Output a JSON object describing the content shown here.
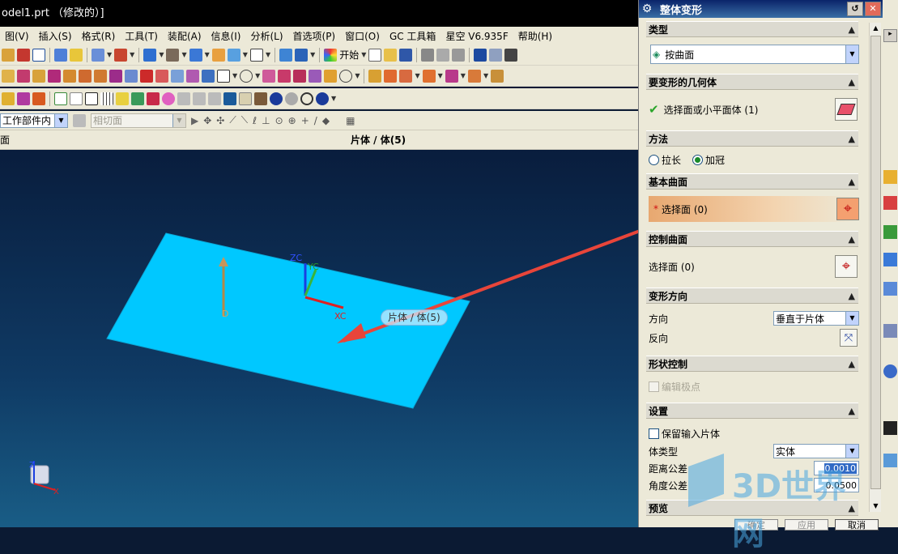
{
  "window": {
    "title": "odel1.prt （修改的）]"
  },
  "menu": [
    "图(V)",
    "插入(S)",
    "格式(R)",
    "工具(T)",
    "装配(A)",
    "信息(I)",
    "分析(L)",
    "首选项(P)",
    "窗口(O)",
    "GC 工具箱",
    "星空 V6.935F",
    "帮助(H)"
  ],
  "toolbar": {
    "start_label": "开始"
  },
  "filter": {
    "scope_value": "工作部件内",
    "snap_value": "相切面"
  },
  "selection_bar": {
    "left_label": "面",
    "right_label": "片体 / 体(5)"
  },
  "viewport": {
    "tooltip": "片体 / 体(5)",
    "axis_zc": "ZC",
    "axis_yc": "YC",
    "axis_xc": "XC",
    "axis_d": "D",
    "triad_z": "Z",
    "triad_x": "X",
    "colors": {
      "sheet": "#00c8ff",
      "arrow": "#e8453a"
    }
  },
  "dialog": {
    "title": "整体变形",
    "sections": {
      "type": "类型",
      "geometry": "要变形的几何体",
      "method": "方法",
      "base": "基本曲面",
      "control": "控制曲面",
      "direction": "变形方向",
      "shape": "形状控制",
      "settings": "设置",
      "preview": "预览"
    },
    "type_value": "按曲面",
    "geometry_select": "选择面或小平面体 (1)",
    "method_options": [
      "拉长",
      "加冠"
    ],
    "method_selected": "加冠",
    "base_select": "选择面 (0)",
    "control_select": "选择面 (0)",
    "direction_label": "方向",
    "direction_value": "垂直于片体",
    "reverse_label": "反向",
    "edit_poles": "编辑极点",
    "keep_input": "保留输入片体",
    "body_type_label": "体类型",
    "body_type_value": "实体",
    "dist_tol_label": "距离公差",
    "dist_tol_value": "0.0010",
    "angle_tol_label": "角度公差",
    "angle_tol_value": "0.0500",
    "buttons": {
      "ok": "确定",
      "apply": "应用",
      "cancel": "取消"
    }
  },
  "watermark": "3D世界网"
}
